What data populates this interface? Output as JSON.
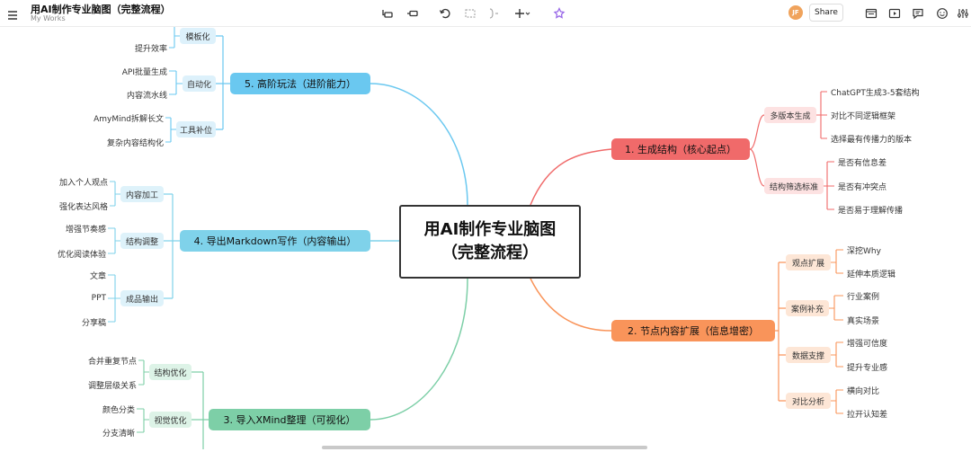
{
  "header": {
    "title": "用AI制作专业脑图（完整流程）",
    "subtitle": "My Works",
    "share_label": "Share",
    "avatar_initials": "JF"
  },
  "colors": {
    "red": "#f06a6a",
    "red_light": "#fde2e2",
    "orange": "#f9945a",
    "orange_light": "#fde6d6",
    "green": "#7dcfa7",
    "green_light": "#ddf3e7",
    "cyan": "#7fd2ea",
    "cyan_light": "#def2fa",
    "blue": "#6ac8f0",
    "blue_light": "#ddf1fb",
    "purple": "#9a6ae8"
  },
  "mindmap": {
    "center": {
      "line1": "用AI制作专业脑图",
      "line2": "（完整流程）"
    },
    "branch1": {
      "label": "1. 生成结构（核心起点）",
      "groups": [
        {
          "label": "多版本生成",
          "leaves": [
            "ChatGPT生成3-5套结构",
            "对比不同逻辑框架",
            "选择最有传播力的版本"
          ]
        },
        {
          "label": "结构筛选标准",
          "leaves": [
            "是否有信息差",
            "是否有冲突点",
            "是否易于理解传播"
          ]
        }
      ]
    },
    "branch2": {
      "label": "2. 节点内容扩展（信息增密）",
      "groups": [
        {
          "label": "观点扩展",
          "leaves": [
            "深挖Why",
            "延伸本质逻辑"
          ]
        },
        {
          "label": "案例补充",
          "leaves": [
            "行业案例",
            "真实场景"
          ]
        },
        {
          "label": "数据支撑",
          "leaves": [
            "增强可信度",
            "提升专业感"
          ]
        },
        {
          "label": "对比分析",
          "leaves": [
            "横向对比",
            "拉开认知差"
          ]
        }
      ]
    },
    "branch3": {
      "label": "3. 导入XMind整理（可视化）",
      "groups": [
        {
          "label": "结构优化",
          "leaves": [
            "合并重复节点",
            "调整层级关系"
          ]
        },
        {
          "label": "视觉优化",
          "leaves": [
            "颜色分类",
            "分支清晰"
          ]
        }
      ]
    },
    "branch4": {
      "label": "4. 导出Markdown写作（内容输出）",
      "groups": [
        {
          "label": "内容加工",
          "leaves": [
            "加入个人观点",
            "强化表达风格"
          ]
        },
        {
          "label": "结构调整",
          "leaves": [
            "增强节奏感",
            "优化阅读体验"
          ]
        },
        {
          "label": "成品输出",
          "leaves": [
            "文章",
            "PPT",
            "分享稿"
          ]
        }
      ]
    },
    "branch5": {
      "label": "5. 高阶玩法（进阶能力）",
      "groups": [
        {
          "label": "模板化",
          "leaves": [
            "提升效率"
          ]
        },
        {
          "label": "自动化",
          "leaves": [
            "API批量生成",
            "内容流水线"
          ]
        },
        {
          "label": "工具补位",
          "leaves": [
            "AmyMind拆解长文",
            "复杂内容结构化"
          ]
        }
      ]
    }
  }
}
